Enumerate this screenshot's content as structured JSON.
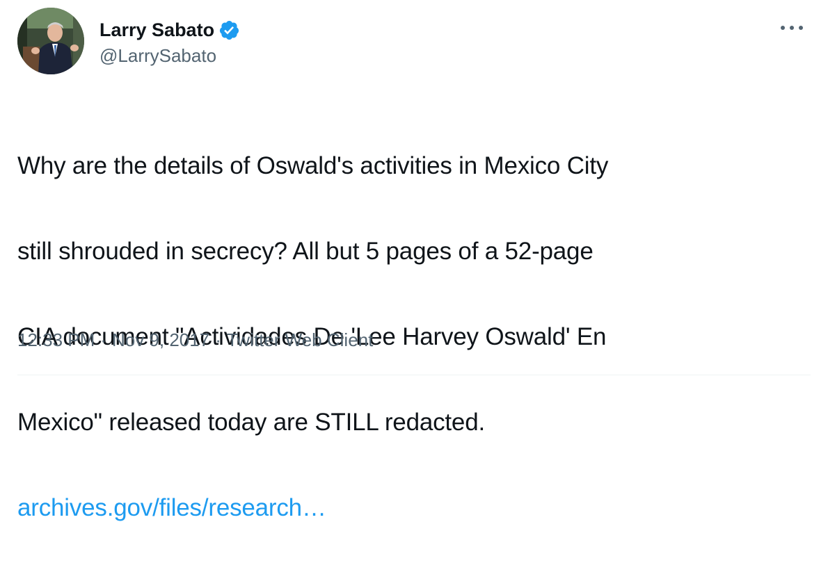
{
  "author": {
    "display_name": "Larry Sabato",
    "handle": "@LarrySabato",
    "verified": true
  },
  "tweet": {
    "text_lines": [
      "Why are the details of Oswald's activities in Mexico City",
      "still shrouded in secrecy? All but 5 pages of a 52-page",
      "CIA document \"Actividades De 'Lee Harvey Oswald' En",
      "Mexico\" released today are STILL redacted."
    ],
    "link_text": "archives.gov/files/research…"
  },
  "meta": {
    "time": "12:33 PM",
    "separator": "·",
    "date": "Nov 9, 2017",
    "source": "Twitter Web Client"
  },
  "icons": {
    "verified": "verified-badge-icon",
    "more": "more-options-icon"
  },
  "colors": {
    "text": "#0f1419",
    "secondary": "#536471",
    "link": "#1d9bf0",
    "verified": "#1d9bf0"
  }
}
